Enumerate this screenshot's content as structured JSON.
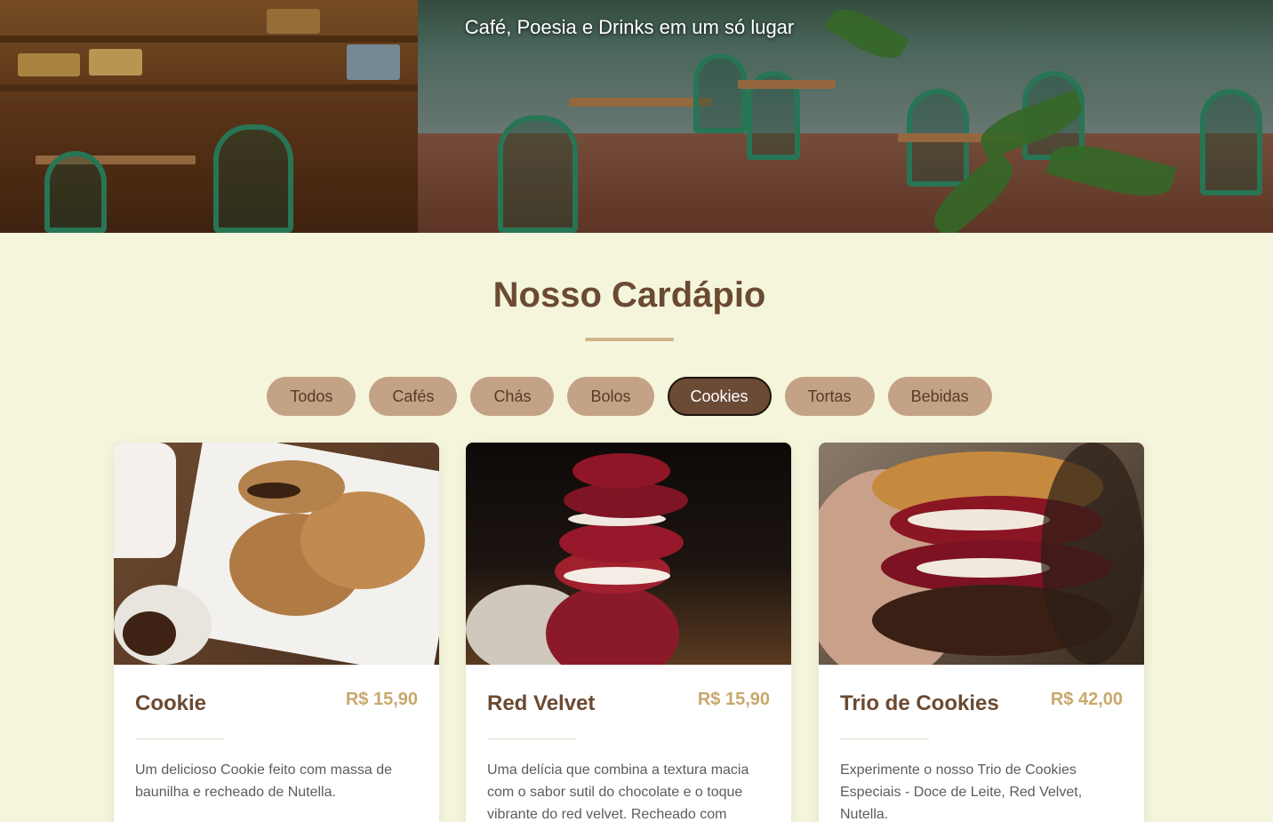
{
  "hero": {
    "tagline": "Café, Poesia e Drinks em um só lugar"
  },
  "menu": {
    "title": "Nosso Cardápio",
    "filters": [
      {
        "label": "Todos",
        "active": false
      },
      {
        "label": "Cafés",
        "active": false
      },
      {
        "label": "Chás",
        "active": false
      },
      {
        "label": "Bolos",
        "active": false
      },
      {
        "label": "Cookies",
        "active": true
      },
      {
        "label": "Tortas",
        "active": false
      },
      {
        "label": "Bebidas",
        "active": false
      }
    ],
    "items": [
      {
        "name": "Cookie",
        "price": "R$ 15,90",
        "description": "Um delicioso Cookie feito com massa de baunilha e recheado de Nutella."
      },
      {
        "name": "Red Velvet",
        "price": "R$ 15,90",
        "description": "Uma delícia que combina a textura macia com o sabor sutil do chocolate e o toque vibrante do red velvet. Recheado com"
      },
      {
        "name": "Trio de Cookies",
        "price": "R$ 42,00",
        "description": "Experimente o nosso Trio de Cookies Especiais - Doce de Leite, Red Velvet, Nutella."
      }
    ]
  },
  "colors": {
    "background": "#f5f5dc",
    "title": "#6b4a32",
    "accent": "#d2b48c",
    "filter": "#c4a286",
    "filter_active": "#6b4a36",
    "price": "#c9a86c"
  }
}
